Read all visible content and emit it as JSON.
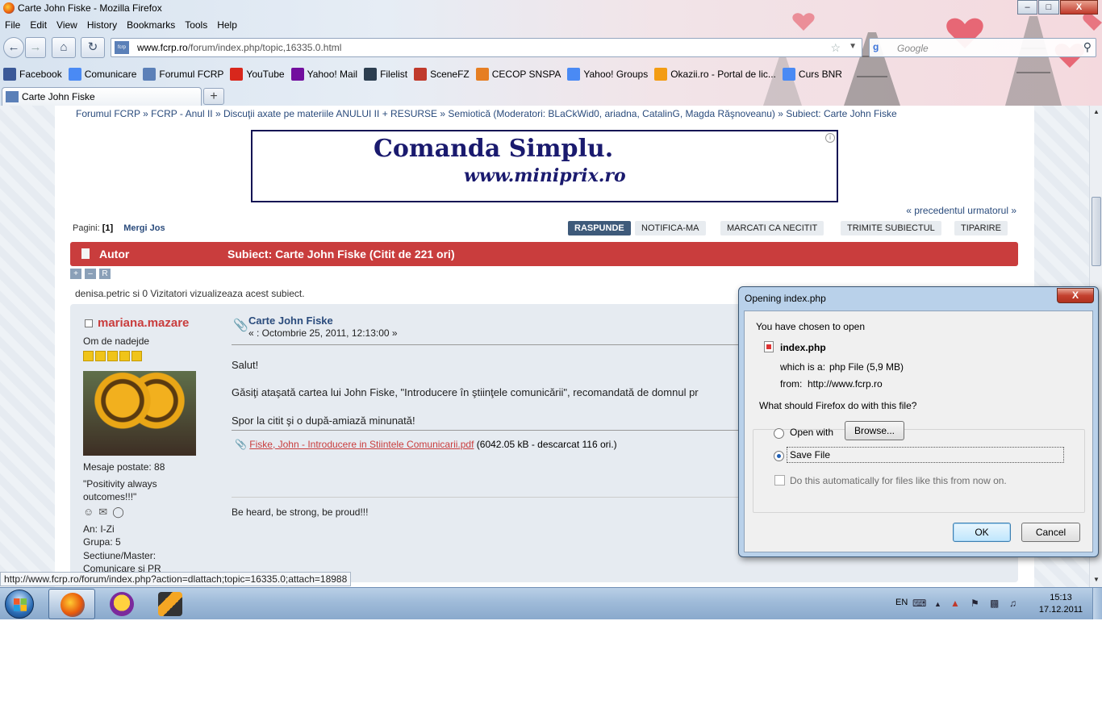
{
  "window": {
    "title": "Carte John Fiske - Mozilla Firefox",
    "minimize": "–",
    "maximize": "□",
    "close": "X"
  },
  "menu": [
    "File",
    "Edit",
    "View",
    "History",
    "Bookmarks",
    "Tools",
    "Help"
  ],
  "nav": {
    "url_host": "www.fcrp.ro",
    "url_path": "/forum/index.php/topic,16335.0.html",
    "search_placeholder": "Google"
  },
  "bookmarks": [
    {
      "label": "Facebook",
      "icon": "facebook-icon",
      "color": "#3b5998"
    },
    {
      "label": "Comunicare",
      "icon": "google-groups-icon",
      "color": "#4a8af4"
    },
    {
      "label": "Forumul FCRP",
      "icon": "fcrp-icon",
      "color": "#5b80b8"
    },
    {
      "label": "YouTube",
      "icon": "youtube-icon",
      "color": "#d8271c"
    },
    {
      "label": "Yahoo! Mail",
      "icon": "yahoo-icon",
      "color": "#720e9e"
    },
    {
      "label": "Filelist",
      "icon": "filelist-icon",
      "color": "#2c3e50"
    },
    {
      "label": "SceneFZ",
      "icon": "scenefz-icon",
      "color": "#c0392b"
    },
    {
      "label": "CECOP SNSPA",
      "icon": "cecop-icon",
      "color": "#e67e22"
    },
    {
      "label": "Yahoo! Groups",
      "icon": "google-groups-icon",
      "color": "#4a8af4"
    },
    {
      "label": "Okazii.ro - Portal de lic...",
      "icon": "okazii-icon",
      "color": "#f39c12"
    },
    {
      "label": "Curs BNR",
      "icon": "google-groups-icon",
      "color": "#4a8af4"
    }
  ],
  "tab": {
    "title": "Carte John Fiske",
    "new_tab": "+"
  },
  "forum": {
    "breadcrumb": "Forumul FCRP » FCRP - Anul II » Discuţii axate pe materiile ANULUI II + RESURSE » Semiotică (Moderatori: BLaCkWid0, ariadna, CatalinG, Magda Răşnoveanu) » Subiect: Carte John Fiske",
    "banner_line1": "Comanda Simplu.",
    "banner_line2": "www.miniprix.ro",
    "banner_info": "i",
    "prev_next": "« precedentul urmatorul »",
    "pages_label": "Pagini:",
    "current_page": "[1]",
    "goto_bottom": "Mergi Jos",
    "actions": [
      "RASPUNDE",
      "NOTIFICA-MA",
      "MARCATI CA NECITIT",
      "TRIMITE SUBIECTUL",
      "TIPARIRE"
    ],
    "header_author": "Autor",
    "header_subject": "Subiect: Carte John Fiske  (Citit de 221 ori)",
    "tools": [
      "+",
      "–",
      "R"
    ],
    "viewers": "denisa.petric si 0 Vizitatori vizualizeaza acest subiect.",
    "poster": {
      "username": "mariana.mazare",
      "rank": "Om de nadejde",
      "stars": 5,
      "posts": "Mesaje postate: 88",
      "quote_line1": "\"Positivity always",
      "quote_line2": "outcomes!!!\"",
      "year": "An: I-Zi",
      "group": "Grupa: 5",
      "section_label": "Sectiune/Master:",
      "section_value": "Comunicare si PR"
    },
    "post": {
      "title": "Carte John Fiske",
      "date": "« : Octombrie 25, 2011, 12:13:00 »",
      "line1": "Salut!",
      "line2": "Găsiţi ataşată cartea lui John Fiske, \"Introducere în ştiinţele comunicării\", recomandată de domnul pr",
      "line3": "Spor la citit şi o după-amiază minunată!",
      "attachment_link": "Fiske, John - Introducere in Stiintele Comunicarii.pdf",
      "attachment_info": "(6042.05 kB - descarcat 116 ori.)",
      "signature": "Be heard, be strong, be proud!!!"
    }
  },
  "status_url": "http://www.fcrp.ro/forum/index.php?action=dlattach;topic=16335.0;attach=18988",
  "dialog": {
    "title": "Opening index.php",
    "close": "X",
    "chosen": "You have chosen to open",
    "filename": "index.php",
    "which_label": "which is a:",
    "which_value": "php File (5,9  MB)",
    "from_label": "from:",
    "from_value": "http://www.fcrp.ro",
    "question": "What should Firefox do with this file?",
    "open_with": "Open with",
    "browse": "Browse...",
    "save_file": "Save File",
    "auto": "Do this automatically for files like this from now on.",
    "ok": "OK",
    "cancel": "Cancel"
  },
  "taskbar": {
    "lang": "EN",
    "time": "15:13",
    "date": "17.12.2011"
  }
}
